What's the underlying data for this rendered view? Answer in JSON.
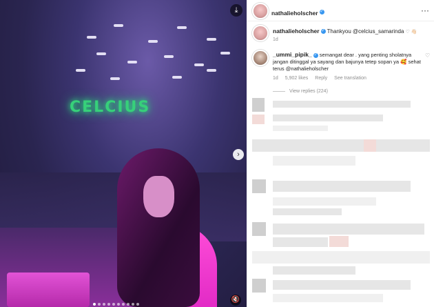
{
  "post": {
    "username": "nathalieholscher",
    "more_label": "···"
  },
  "caption": {
    "username": "nathalieholscher",
    "text": "Thankyou",
    "mention": "@celcius_samarinda",
    "emoji": "♡ 👋🏻",
    "time": "1d"
  },
  "comment": {
    "username": "_ummi_pipik_",
    "text": "semangat dear . yang penting sholatnya jangan ditinggal ya sayang dan bajunya tetep sopan ya 🥰 sehat terus",
    "mention": "@nathalieholscher",
    "time": "1d",
    "likes": "5,902 likes",
    "reply_label": "Reply",
    "translate_label": "See translation",
    "heart": "♡"
  },
  "replies": {
    "label": "View replies (224)"
  },
  "media": {
    "sign_text": "CELCIUS",
    "download_icon": "⤓",
    "next_icon": "›",
    "mute_icon": "🔇",
    "dots_count": 10,
    "active_dot": 0
  },
  "colors": {
    "verified": "#3897f0",
    "text": "#262626",
    "muted": "#8e8e8e",
    "sign": "#37d07a"
  }
}
